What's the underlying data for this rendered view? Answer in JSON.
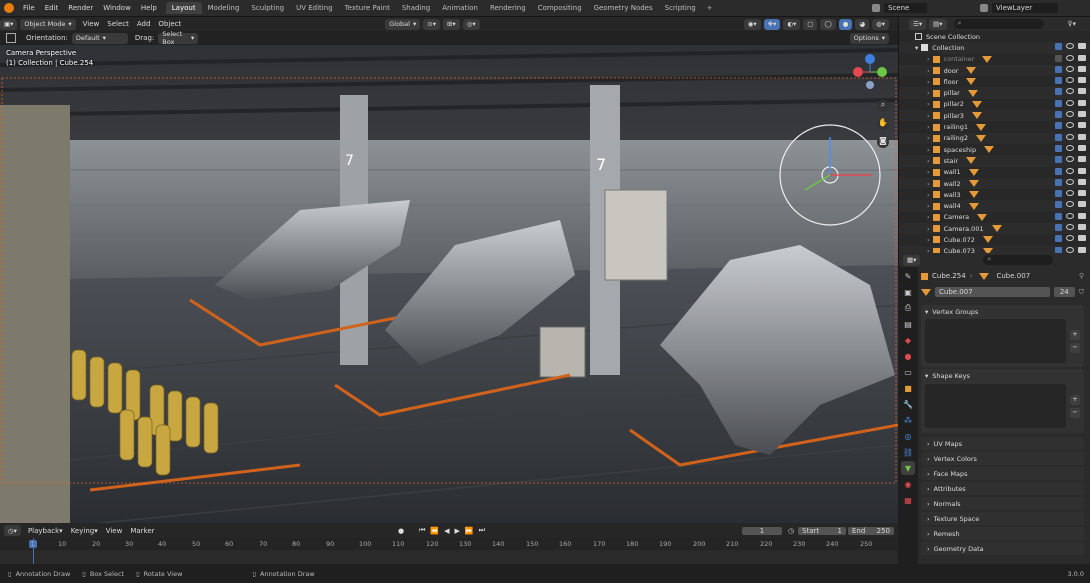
{
  "menu": [
    "File",
    "Edit",
    "Render",
    "Window",
    "Help"
  ],
  "workspaces": [
    "Layout",
    "Modeling",
    "Sculpting",
    "UV Editing",
    "Texture Paint",
    "Shading",
    "Animation",
    "Rendering",
    "Compositing",
    "Geometry Nodes",
    "Scripting"
  ],
  "active_workspace": "Layout",
  "scene_name": "Scene",
  "view_layer": "ViewLayer",
  "viewport_header": {
    "mode": "Object Mode",
    "menus": [
      "View",
      "Select",
      "Add",
      "Object"
    ],
    "transform": "Global"
  },
  "tool_header": {
    "orientation_label": "Orientation:",
    "orientation_value": "Default",
    "drag_label": "Drag:",
    "drag_value": "Select Box",
    "options": "Options"
  },
  "viewport": {
    "camera_label": "Camera Perspective",
    "collection_label": "(1) Collection | Cube.254",
    "pillar_numbers": [
      "7",
      "7"
    ]
  },
  "outliner": {
    "root": "Scene Collection",
    "collection": "Collection",
    "items": [
      {
        "name": "container",
        "visible": false
      },
      {
        "name": "door",
        "visible": true
      },
      {
        "name": "floor",
        "visible": true
      },
      {
        "name": "pillar",
        "visible": true
      },
      {
        "name": "pillar2",
        "visible": true
      },
      {
        "name": "pillar3",
        "visible": true
      },
      {
        "name": "railing1",
        "visible": true
      },
      {
        "name": "railing2",
        "visible": true
      },
      {
        "name": "spaceship",
        "visible": true
      },
      {
        "name": "stair",
        "visible": true
      },
      {
        "name": "wall1",
        "visible": true
      },
      {
        "name": "wall2",
        "visible": true
      },
      {
        "name": "wall3",
        "visible": true
      },
      {
        "name": "wall4",
        "visible": true
      },
      {
        "name": "Camera",
        "visible": true
      },
      {
        "name": "Camera.001",
        "visible": true
      },
      {
        "name": "Cube.072",
        "visible": true
      },
      {
        "name": "Cube.073",
        "visible": true
      }
    ]
  },
  "properties": {
    "object_name": "Cube.254",
    "mesh_name": "Cube.007",
    "mesh_field": "Cube.007",
    "users": "24",
    "panels_open": [
      "Vertex Groups",
      "Shape Keys"
    ],
    "panels_closed": [
      "UV Maps",
      "Vertex Colors",
      "Face Maps",
      "Attributes",
      "Normals",
      "Texture Space",
      "Remesh",
      "Geometry Data"
    ]
  },
  "timeline": {
    "menus": [
      "Playback",
      "Keying",
      "View",
      "Marker"
    ],
    "current_frame": "1",
    "start_label": "Start",
    "start": "1",
    "end_label": "End",
    "end": "250",
    "ruler": [
      "1",
      "10",
      "20",
      "30",
      "40",
      "50",
      "60",
      "70",
      "80",
      "90",
      "100",
      "110",
      "120",
      "130",
      "140",
      "150",
      "160",
      "170",
      "180",
      "190",
      "200",
      "210",
      "220",
      "230",
      "240",
      "250"
    ]
  },
  "status_bar": {
    "items": [
      "Annotation Draw",
      "Box Select",
      "Rotate View",
      "Annotation Draw"
    ],
    "version": "3.0.0"
  },
  "colors": {
    "accent": "#4772b3",
    "orange": "#e49a39",
    "select": "#f08a1c"
  }
}
